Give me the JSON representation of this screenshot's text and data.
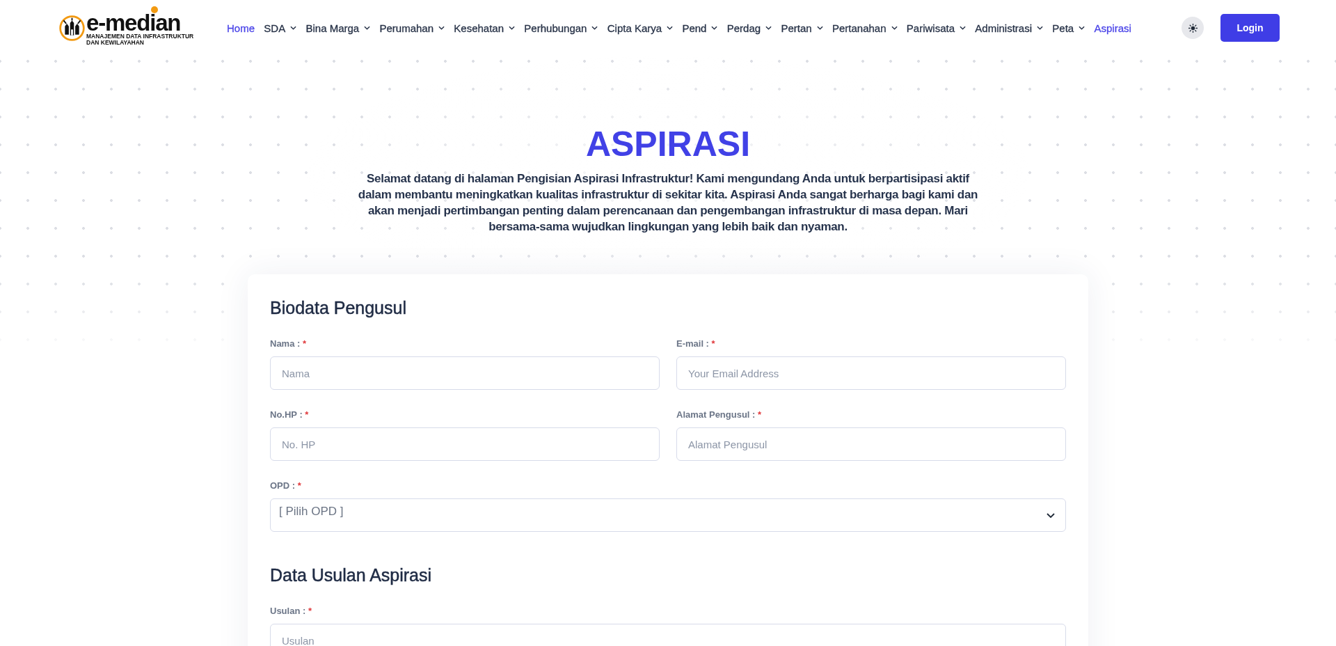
{
  "header": {
    "logo": {
      "wordmark": "e-median",
      "tagline": "MANAJEMEN DATA INFRASTRUKTUR DAN KEWILAYAHAN"
    },
    "nav": [
      {
        "label": "Home",
        "selected": true,
        "dropdown": false
      },
      {
        "label": "SDA",
        "selected": false,
        "dropdown": true
      },
      {
        "label": "Bina Marga",
        "selected": false,
        "dropdown": true
      },
      {
        "label": "Perumahan",
        "selected": false,
        "dropdown": true
      },
      {
        "label": "Kesehatan",
        "selected": false,
        "dropdown": true
      },
      {
        "label": "Perhubungan",
        "selected": false,
        "dropdown": true
      },
      {
        "label": "Cipta Karya",
        "selected": false,
        "dropdown": true
      },
      {
        "label": "Pend",
        "selected": false,
        "dropdown": true
      },
      {
        "label": "Perdag",
        "selected": false,
        "dropdown": true
      },
      {
        "label": "Pertan",
        "selected": false,
        "dropdown": true
      },
      {
        "label": "Pertanahan",
        "selected": false,
        "dropdown": true
      },
      {
        "label": "Pariwisata",
        "selected": false,
        "dropdown": true
      },
      {
        "label": "Administrasi",
        "selected": false,
        "dropdown": true
      },
      {
        "label": "Peta",
        "selected": false,
        "dropdown": true
      },
      {
        "label": "Aspirasi",
        "selected": true,
        "dropdown": false
      }
    ],
    "login_button": "Login"
  },
  "hero": {
    "title": "ASPIRASI",
    "intro": "Selamat datang di halaman Pengisian Aspirasi Infrastruktur! Kami mengundang Anda untuk berpartisipasi aktif dalam membantu meningkatkan kualitas infrastruktur di sekitar kita. Aspirasi Anda sangat berharga bagi kami dan akan menjadi pertimbangan penting dalam perencanaan dan pengembangan infrastruktur di masa depan. Mari bersama-sama wujudkan lingkungan yang lebih baik dan nyaman."
  },
  "form": {
    "sections": [
      {
        "title": "Biodata Pengusul",
        "rows": [
          [
            {
              "kind": "text",
              "label": "Nama :",
              "required_mark": "*",
              "placeholder": "Nama"
            },
            {
              "kind": "text",
              "label": "E-mail :",
              "required_mark": "*",
              "placeholder": "Your Email Address"
            }
          ],
          [
            {
              "kind": "text",
              "label": "No.HP :",
              "required_mark": "*",
              "placeholder": "No. HP"
            },
            {
              "kind": "text",
              "label": "Alamat Pengusul :",
              "required_mark": "*",
              "placeholder": "Alamat Pengusul"
            }
          ],
          [
            {
              "kind": "select",
              "label": "OPD :",
              "required_mark": "*",
              "placeholder": "[ Pilih OPD ]"
            }
          ]
        ]
      },
      {
        "title": "Data Usulan Aspirasi",
        "rows": [
          [
            {
              "kind": "text",
              "label": "Usulan :",
              "required_mark": "*",
              "placeholder": "Usulan"
            }
          ]
        ]
      }
    ]
  }
}
